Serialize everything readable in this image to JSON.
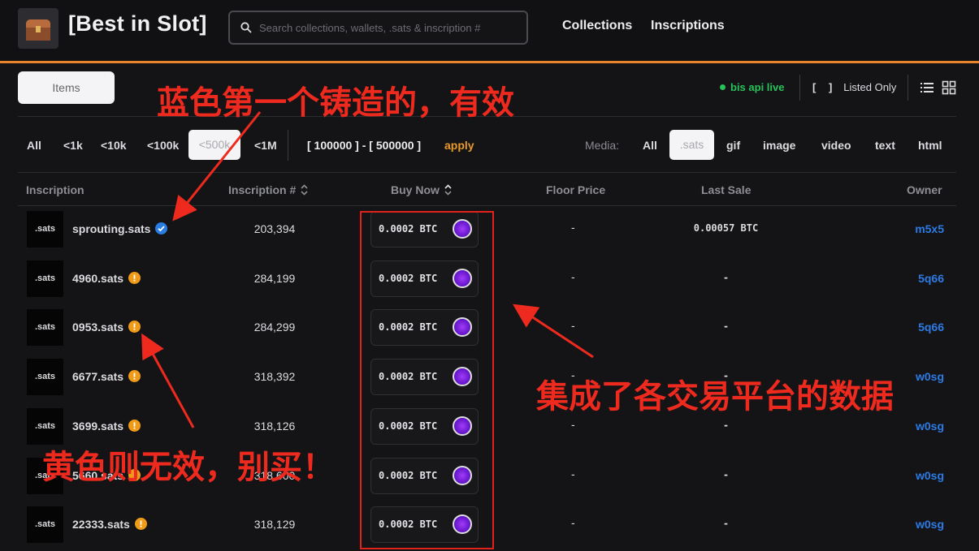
{
  "header": {
    "brand": "[Best in Slot]",
    "search_placeholder": "Search collections, wallets, .sats & inscription #",
    "nav": [
      "Collections",
      "Inscriptions"
    ]
  },
  "toolbar": {
    "items_tab": "Items",
    "api_status": "bis api live",
    "listed_bracket": "[ ]",
    "listed_only": "Listed Only"
  },
  "filters": {
    "range_options": [
      "All",
      "<1k",
      "<10k",
      "<100k",
      "<500k",
      "<1M"
    ],
    "active_range": "<500k",
    "custom_range": "[ 100000 ] - [ 500000 ]",
    "apply": "apply",
    "media_label": "Media:",
    "media_options": [
      "All",
      ".sats",
      "gif",
      "image",
      "video",
      "text",
      "html"
    ],
    "active_media": ".sats"
  },
  "table": {
    "headers": [
      "Inscription",
      "Inscription #",
      "Buy Now",
      "Floor Price",
      "Last Sale",
      "Owner"
    ],
    "rows": [
      {
        "thumb": ".sats",
        "name": "sprouting.sats",
        "badge": "verified",
        "number": "203,394",
        "buy_now": "0.0002 BTC",
        "floor": "-",
        "last_sale": "0.00057 BTC",
        "owner": "m5x5"
      },
      {
        "thumb": ".sats",
        "name": "4960.sats",
        "badge": "warning",
        "number": "284,199",
        "buy_now": "0.0002 BTC",
        "floor": "-",
        "last_sale": "-",
        "owner": "5q66"
      },
      {
        "thumb": ".sats",
        "name": "0953.sats",
        "badge": "warning",
        "number": "284,299",
        "buy_now": "0.0002 BTC",
        "floor": "-",
        "last_sale": "-",
        "owner": "5q66"
      },
      {
        "thumb": ".sats",
        "name": "6677.sats",
        "badge": "warning",
        "number": "318,392",
        "buy_now": "0.0002 BTC",
        "floor": "-",
        "last_sale": "-",
        "owner": "w0sg"
      },
      {
        "thumb": ".sats",
        "name": "3699.sats",
        "badge": "warning",
        "number": "318,126",
        "buy_now": "0.0002 BTC",
        "floor": "-",
        "last_sale": "-",
        "owner": "w0sg"
      },
      {
        "thumb": ".sats",
        "name": "5660.sats",
        "badge": "warning",
        "number": "318,600",
        "buy_now": "0.0002 BTC",
        "floor": "-",
        "last_sale": "-",
        "owner": "w0sg"
      },
      {
        "thumb": ".sats",
        "name": "22333.sats",
        "badge": "warning",
        "number": "318,129",
        "buy_now": "0.0002 BTC",
        "floor": "-",
        "last_sale": "-",
        "owner": "w0sg"
      }
    ]
  },
  "annotations": {
    "blue_valid": "蓝色第一个铸造的，有效",
    "integrated": "集成了各交易平台的数据",
    "yellow_invalid": "黄色则无效，别买！"
  },
  "colors": {
    "accent": "#e8842c",
    "verified": "#2a7de1",
    "warning": "#ef9b17",
    "owner_link": "#2c7be5",
    "live": "#27c25a",
    "annotation": "#ee2a1f"
  }
}
